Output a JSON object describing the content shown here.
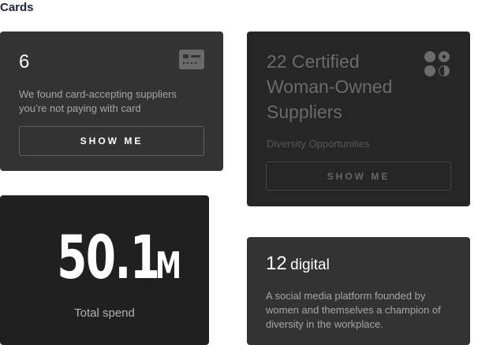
{
  "heading": "Cards",
  "card_supplier": {
    "count": "6",
    "description": "We found card-accepting suppliers you’re not paying with card",
    "button_label": "SHOW ME",
    "icon": "credit-card-icon"
  },
  "card_diversity": {
    "title": "22 Certified Woman-Owned Suppliers",
    "subtitle": "Diversity Opportunities",
    "button_label": "SHOW ME",
    "icon": "grid-dots-icon"
  },
  "card_spend": {
    "value": "50.1",
    "unit": "M",
    "label": "Total spend"
  },
  "card_digital": {
    "count": "12",
    "word": "digital",
    "description": "A social media platform founded by women and themselves a champion of diversity in the workplace."
  },
  "colors": {
    "card_dark": "#333333",
    "card_darker": "#262626",
    "card_darkest": "#202020",
    "heading_text": "#1c2340"
  }
}
